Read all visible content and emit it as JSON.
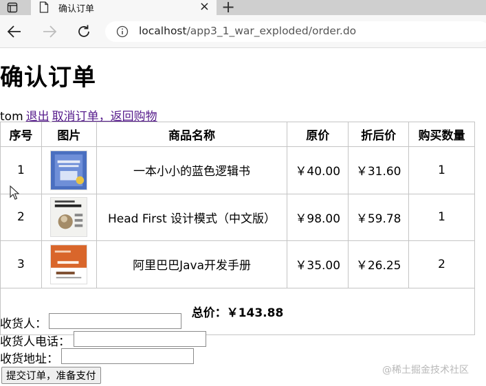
{
  "browser": {
    "tab_title": "确认订单",
    "tab_close_glyph": "×",
    "new_tab_glyph": "+",
    "url_host": "localhost",
    "url_path": "/app3_1_war_exploded/order.do",
    "icons": [
      "window-menu-icon",
      "page-icon",
      "back-arrow-icon",
      "forward-arrow-icon",
      "reload-icon",
      "info-icon"
    ]
  },
  "page": {
    "title": "确认订单",
    "username": "tom",
    "logout_link": "退出",
    "cancel_link": "取消订单，返回购物"
  },
  "table": {
    "headers": {
      "no": "序号",
      "image": "图片",
      "name": "商品名称",
      "price": "原价",
      "discount": "折后价",
      "qty": "购买数量"
    },
    "rows": [
      {
        "no": "1",
        "name": "一本小小的蓝色逻辑书",
        "price": "￥40.00",
        "discount": "￥31.60",
        "qty": "1",
        "cover": "blue-book-cover"
      },
      {
        "no": "2",
        "name": "Head First 设计模式（中文版）",
        "price": "￥98.00",
        "discount": "￥59.78",
        "qty": "1",
        "cover": "head-first-cover"
      },
      {
        "no": "3",
        "name": "阿里巴巴Java开发手册",
        "price": "￥35.00",
        "discount": "￥26.25",
        "qty": "2",
        "cover": "alibaba-java-cover"
      }
    ],
    "total_label": "总价：￥143.88"
  },
  "form": {
    "receiver_label": "收货人：",
    "receiver_value": "",
    "phone_label": "收货人电话：",
    "phone_value": "",
    "address_label": "收货地址：",
    "address_value": "",
    "submit_label": "提交订单，准备支付"
  },
  "watermark": "@稀土掘金技术社区",
  "colors": {
    "link": "#551a8b",
    "tabbar": "#cfcfcf",
    "toolbar": "#f7f7f7"
  }
}
